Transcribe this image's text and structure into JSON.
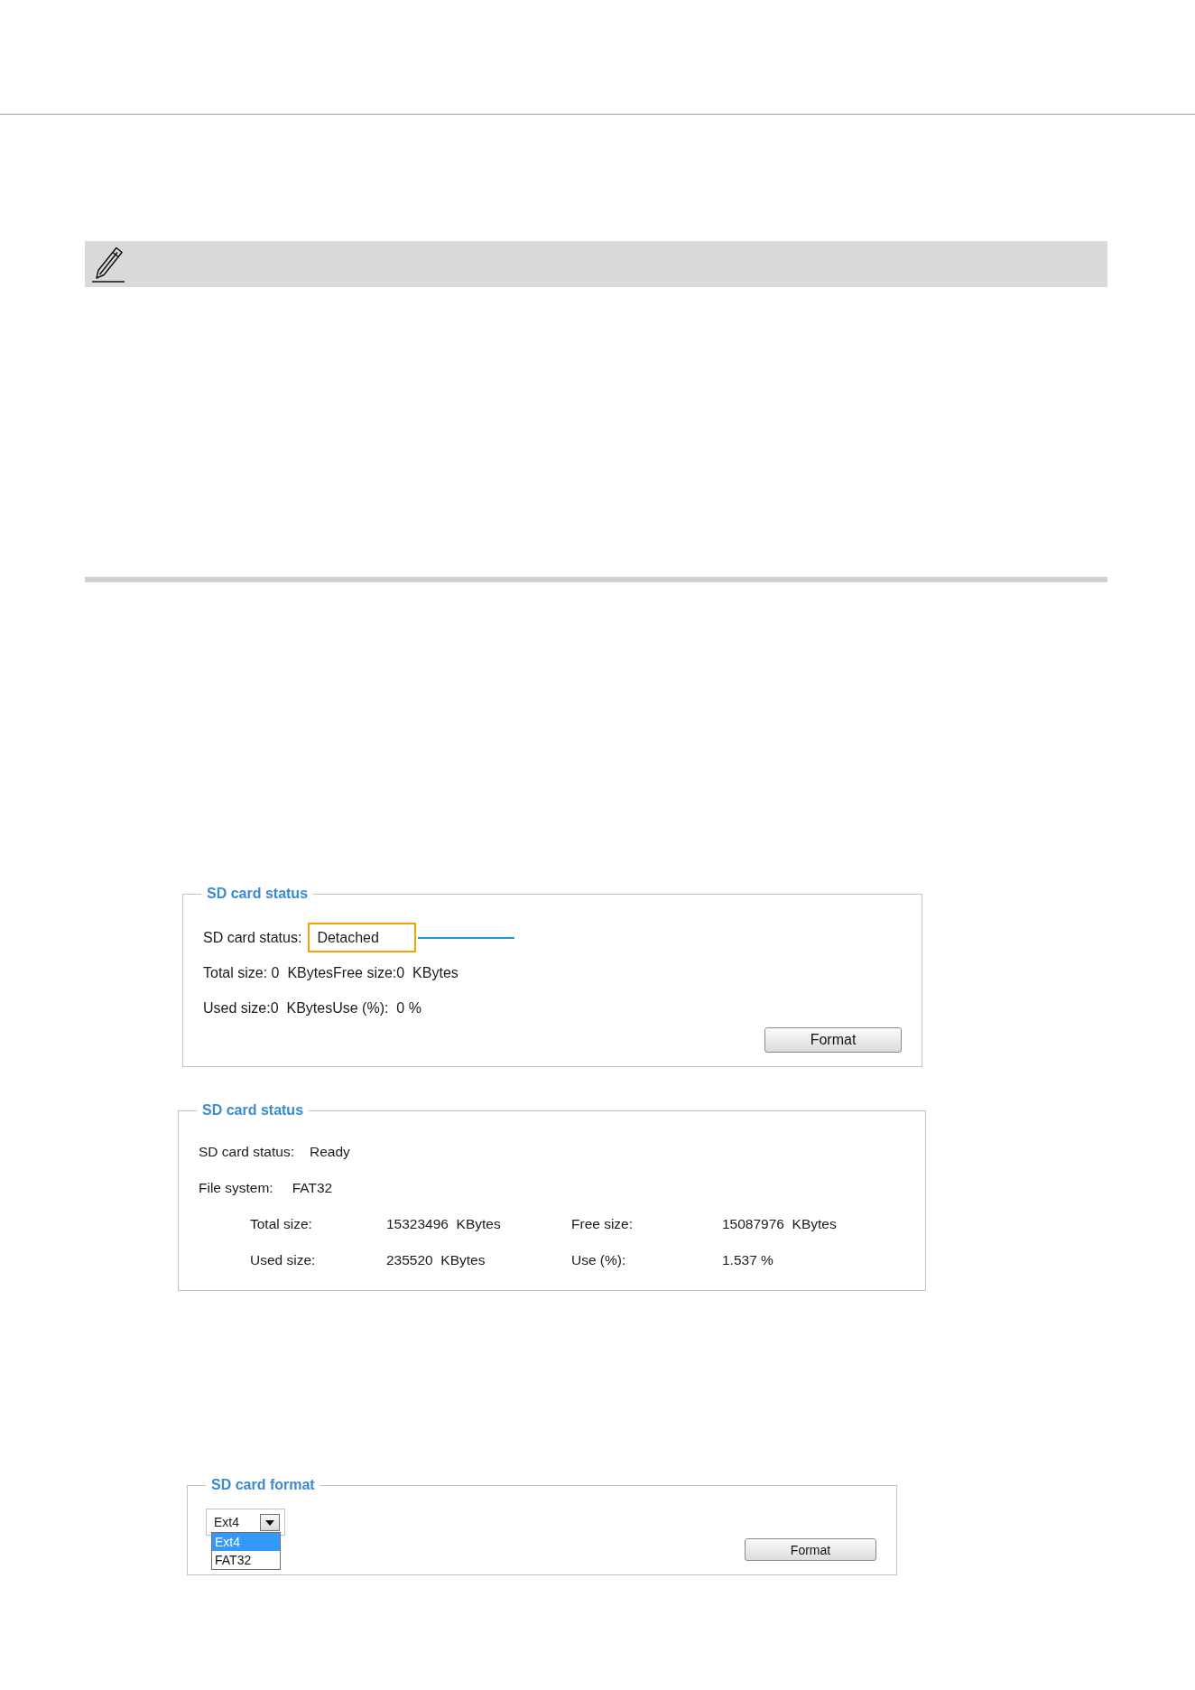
{
  "status_panels": [
    {
      "kind": "inline",
      "legend": "SD card status",
      "status": {
        "label": "SD card status:",
        "value": "Detached",
        "highlighted": true
      },
      "lines": [
        "Total size: 0  KBytesFree size:0  KBytes",
        "Used size:0  KBytesUse (%):  0 %"
      ],
      "button": "Format"
    },
    {
      "kind": "grid",
      "legend": "SD card status",
      "status": {
        "label": "SD card status:",
        "value": "Ready",
        "highlighted": false
      },
      "file_system": {
        "label": "File system:",
        "value": "FAT32"
      },
      "size_rows": [
        [
          "Total size:",
          "15323496  KBytes",
          "Free size:",
          "15087976  KBytes"
        ],
        [
          "Used size:",
          "235520  KBytes",
          "Use (%):",
          "1.537 %"
        ]
      ]
    }
  ],
  "format_panel": {
    "legend": "SD card format",
    "select": {
      "value": "Ext4",
      "options": [
        {
          "label": "Ext4",
          "selected": true
        },
        {
          "label": "FAT32",
          "selected": false
        }
      ]
    },
    "button": "Format"
  }
}
